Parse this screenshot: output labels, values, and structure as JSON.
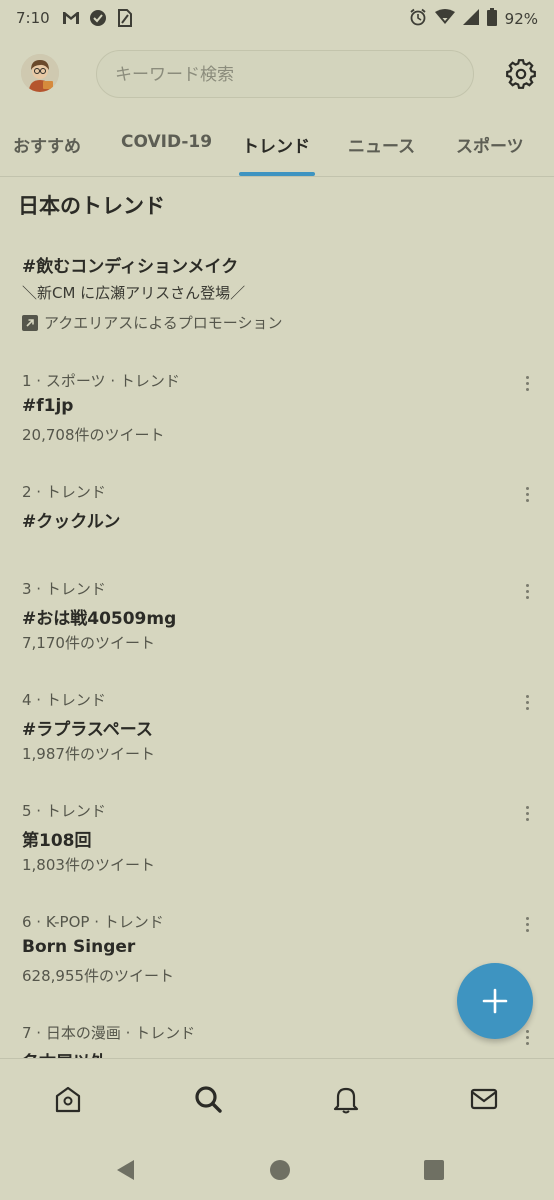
{
  "status_bar": {
    "time": "7:10",
    "battery": "92%",
    "left_icons": [
      "gmail-icon",
      "shield-check-icon",
      "sim-icon"
    ],
    "right_icons": [
      "alarm-icon",
      "wifi-icon",
      "signal-icon",
      "battery-icon"
    ]
  },
  "header": {
    "search_placeholder": "キーワード検索",
    "avatar_icon": "avatar",
    "settings_icon": "gear-icon"
  },
  "tabs": [
    {
      "label": "おすすめ",
      "active": false
    },
    {
      "label": "COVID-19",
      "active": false
    },
    {
      "label": "トレンド",
      "active": true
    },
    {
      "label": "ニュース",
      "active": false
    },
    {
      "label": "スポーツ",
      "active": false
    }
  ],
  "colors": {
    "accent": "#3e94c1",
    "background": "#d6d6bf",
    "text": "#2b2b26"
  },
  "section_title": "日本のトレンド",
  "promoted": {
    "title": "#飲むコンディションメイク",
    "subtitle": "＼新CM に広瀬アリスさん登場／",
    "promoter": "アクエリアスによるプロモーション"
  },
  "trends": [
    {
      "meta": "1 · スポーツ · トレンド",
      "name": "#f1jp",
      "count": "20,708件のツイート"
    },
    {
      "meta": "2 · トレンド",
      "name": "#クックルン",
      "count": ""
    },
    {
      "meta": "3 · トレンド",
      "name": "#おは戦40509mg",
      "count": "7,170件のツイート"
    },
    {
      "meta": "4 · トレンド",
      "name": "#ラプラスペース",
      "count": "1,987件のツイート"
    },
    {
      "meta": "5 · トレンド",
      "name": "第108回",
      "count": "1,803件のツイート"
    },
    {
      "meta": "6 · K-POP · トレンド",
      "name": "Born Singer",
      "count": "628,955件のツイート"
    },
    {
      "meta": "7 · 日本の漫画 · トレンド",
      "name": "名古屋以外",
      "count": ""
    }
  ],
  "fab_icon": "plus-icon",
  "bottom_nav": [
    "home-icon",
    "search-icon",
    "bell-icon",
    "mail-icon"
  ],
  "system_nav": [
    "back-icon",
    "home-circle-icon",
    "recents-icon"
  ]
}
